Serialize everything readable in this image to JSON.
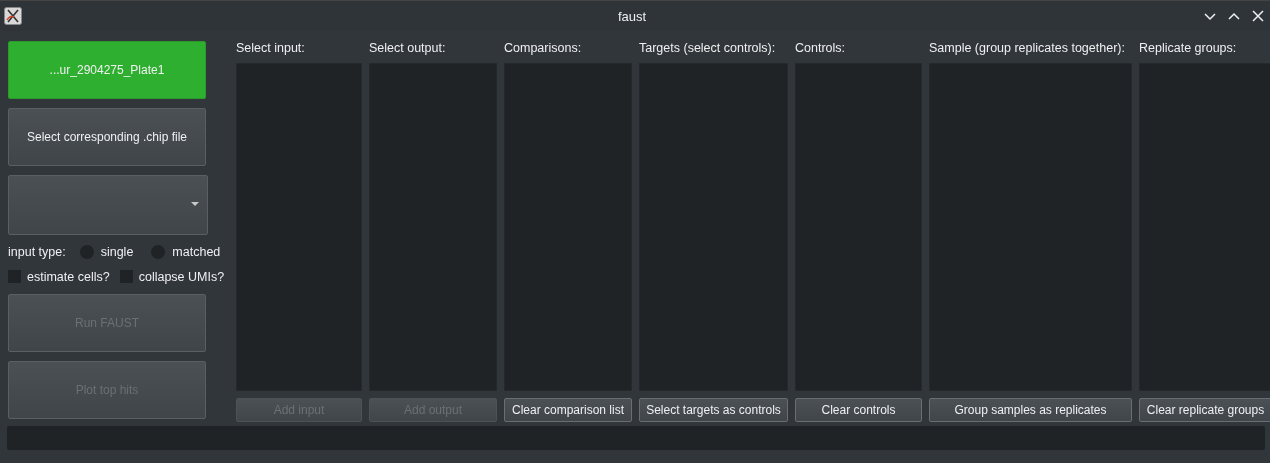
{
  "window": {
    "title": "faust"
  },
  "sidebar": {
    "file_button": "...ur_2904275_Plate1",
    "chip_button": "Select corresponding .chip file",
    "input_type": {
      "label": "input type:",
      "options": [
        {
          "label": "single",
          "selected": false
        },
        {
          "label": "matched",
          "selected": false
        }
      ]
    },
    "checkboxes": [
      {
        "label": "estimate cells?",
        "checked": false
      },
      {
        "label": "collapse UMIs?",
        "checked": false
      }
    ],
    "actions": [
      {
        "label": "Run FAUST",
        "disabled": true
      },
      {
        "label": "Plot top hits",
        "disabled": true
      }
    ]
  },
  "lists": [
    {
      "label": "Select input:",
      "button": {
        "label": "Add input",
        "disabled": true
      }
    },
    {
      "label": "Select output:",
      "button": {
        "label": "Add output",
        "disabled": true
      }
    },
    {
      "label": "Comparisons:",
      "button": {
        "label": "Clear comparison list",
        "disabled": false
      }
    },
    {
      "label": "Targets (select controls):",
      "button": {
        "label": "Select targets as controls",
        "disabled": false
      }
    },
    {
      "label": "Controls:",
      "button": {
        "label": "Clear controls",
        "disabled": false
      }
    },
    {
      "label": "Sample (group replicates together):",
      "button": {
        "label": "Group samples as replicates",
        "disabled": false
      }
    },
    {
      "label": "Replicate groups:",
      "button": {
        "label": "Clear replicate groups",
        "disabled": false
      }
    }
  ]
}
